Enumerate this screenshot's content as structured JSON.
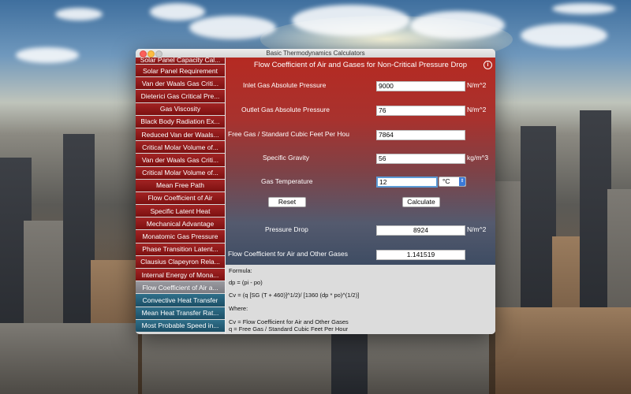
{
  "window": {
    "title": "Basic Thermodynamics Calculators"
  },
  "sidebar": {
    "items": [
      {
        "label": "Solar Panel Capacity Cal..."
      },
      {
        "label": "Solar Panel Requirement"
      },
      {
        "label": "Van der Waals Gas Criti..."
      },
      {
        "label": "Dieterici Gas Critical Pre..."
      },
      {
        "label": "Gas Viscosity"
      },
      {
        "label": "Black Body Radiation Ex..."
      },
      {
        "label": "Reduced Van der Waals..."
      },
      {
        "label": "Critical Molar Volume of..."
      },
      {
        "label": "Van der Waals Gas Criti..."
      },
      {
        "label": "Critical Molar Volume of..."
      },
      {
        "label": "Mean Free Path"
      },
      {
        "label": "Flow Coefficient of Air"
      },
      {
        "label": "Specific Latent Heat"
      },
      {
        "label": "Mechanical Advantage"
      },
      {
        "label": "Monatomic Gas Pressure"
      },
      {
        "label": "Phase Transition Latent..."
      },
      {
        "label": "Clausius Clapeyron Rela..."
      },
      {
        "label": "Internal Energy of Mona..."
      },
      {
        "label": "Flow Coefficient of Air a..."
      },
      {
        "label": "Convective Heat Transfer"
      },
      {
        "label": "Mean Heat Transfer Rat..."
      },
      {
        "label": "Most Probable Speed in..."
      }
    ]
  },
  "main": {
    "title": "Flow Coefficient of Air and Gases for Non-Critical Pressure Drop",
    "inlet": {
      "label": "Inlet Gas Absolute Pressure",
      "value": "9000",
      "unit": "N/m^2"
    },
    "outlet": {
      "label": "Outlet Gas Absolute Pressure",
      "value": "76",
      "unit": "N/m^2"
    },
    "free_gas": {
      "label": "Free Gas / Standard Cubic Feet Per Hou",
      "value": "7864"
    },
    "gravity": {
      "label": "Specific Gravity",
      "value": "56",
      "unit": "kg/m^3"
    },
    "temperature": {
      "label": "Gas Temperature",
      "value": "12",
      "unit_selected": "°C"
    },
    "reset_label": "Reset",
    "calculate_label": "Calculate",
    "pressure_drop": {
      "label": "Pressure Drop",
      "value": "8924",
      "unit": "N/m^2"
    },
    "flow_coeff": {
      "label": "Flow Coefficient for Air and Other Gases",
      "value": "1.141519"
    }
  },
  "formula": {
    "line1": "Formula:",
    "line2": "dp = (pi - po)",
    "line3": "Cv = (q [SG (T + 460)]^1/2)/ [1360 (dp * po)^(1/2)]",
    "line4": "Where:",
    "line5": "Cv = Flow Coefficient for Air and Other Gases",
    "line6": "q = Free Gas / Standard Cubic Feet Per Hour"
  }
}
